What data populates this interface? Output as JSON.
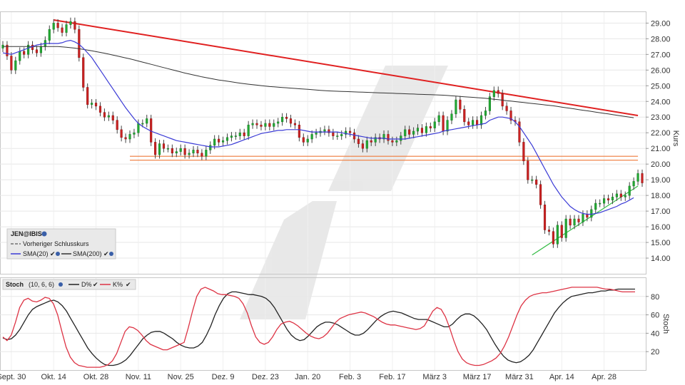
{
  "chart_data": [
    {
      "type": "candlestick",
      "instrument": "JEN@IBIS",
      "ylabel": "Kurs",
      "ylim": [
        13.0,
        29.7
      ],
      "y_ticks": [
        "14.00",
        "15.00",
        "16.00",
        "17.00",
        "18.00",
        "19.00",
        "20.00",
        "21.00",
        "22.00",
        "23.00",
        "24.00",
        "25.00",
        "26.00",
        "27.00",
        "28.00",
        "29.00"
      ],
      "x_ticks": [
        "Sept. 30",
        "Okt. 14",
        "Okt. 28",
        "Nov. 11",
        "Nov. 25",
        "Dez. 9",
        "Dez. 23",
        "Jan. 20",
        "Feb. 3",
        "Feb. 17",
        "März 3",
        "März 17",
        "März 31",
        "Apr. 14",
        "Apr. 28"
      ],
      "legend": {
        "prev_close": "Vorheriger Schlusskurs",
        "sma20": "SMA(20)",
        "sma200": "SMA(200)"
      },
      "colors": {
        "up": "#22aa33",
        "down": "#cc2222",
        "sma20": "#3b3bd6",
        "sma200": "#333333",
        "resistance": "#e02020",
        "support_lines": "#ef7a3a",
        "trend_up": "#33bb44"
      },
      "close": [
        27.6,
        26.9,
        26.0,
        26.6,
        27.2,
        27.0,
        27.6,
        27.3,
        27.1,
        27.5,
        27.9,
        28.6,
        29.0,
        28.7,
        28.4,
        28.9,
        29.1,
        28.6,
        26.8,
        24.9,
        23.8,
        23.9,
        23.7,
        23.3,
        23.0,
        23.1,
        22.8,
        22.2,
        21.7,
        21.6,
        21.9,
        22.0,
        22.6,
        22.6,
        22.9,
        21.4,
        20.6,
        21.3,
        21.0,
        21.0,
        20.7,
        20.8,
        21.0,
        20.6,
        20.7,
        20.9,
        20.7,
        20.5,
        20.9,
        21.2,
        21.6,
        21.4,
        21.5,
        21.7,
        21.8,
        21.8,
        22.0,
        21.8,
        22.5,
        22.6,
        22.5,
        22.4,
        22.6,
        22.4,
        22.6,
        22.7,
        23.0,
        22.9,
        22.6,
        22.5,
        21.7,
        21.4,
        21.6,
        21.9,
        22.0,
        22.1,
        22.2,
        22.0,
        21.8,
        21.8,
        21.9,
        22.1,
        22.0,
        21.6,
        21.3,
        21.0,
        21.5,
        21.4,
        21.7,
        21.6,
        21.9,
        21.5,
        21.4,
        21.5,
        21.8,
        22.2,
        21.9,
        22.1,
        22.3,
        22.0,
        22.4,
        22.3,
        22.7,
        23.1,
        22.1,
        22.8,
        23.2,
        24.1,
        23.5,
        22.7,
        22.5,
        22.8,
        22.5,
        23.1,
        23.4,
        24.3,
        24.7,
        24.5,
        23.7,
        23.4,
        22.8,
        22.7,
        21.4,
        20.2,
        19.0,
        19.0,
        18.7,
        17.4,
        15.8,
        15.7,
        14.9,
        16.1,
        15.3,
        16.5,
        16.1,
        16.5,
        16.3,
        16.8,
        16.6,
        17.1,
        17.5,
        17.5,
        17.8,
        17.7,
        17.9,
        18.1,
        17.9,
        18.0,
        18.6,
        18.9,
        19.4,
        18.8
      ],
      "sma20": [
        27.1,
        27.05,
        27.0,
        27.1,
        27.2,
        27.3,
        27.4,
        27.5,
        27.6,
        27.65,
        27.7,
        27.7,
        27.7,
        27.7,
        27.75,
        27.85,
        27.9,
        27.8,
        27.65,
        27.4,
        27.1,
        26.8,
        26.4,
        26.0,
        25.6,
        25.2,
        24.8,
        24.4,
        24.0,
        23.6,
        23.25,
        22.9,
        22.6,
        22.4,
        22.25,
        22.1,
        22.0,
        21.9,
        21.8,
        21.7,
        21.6,
        21.5,
        21.45,
        21.4,
        21.35,
        21.3,
        21.25,
        21.2,
        21.15,
        21.1,
        21.1,
        21.1,
        21.15,
        21.2,
        21.25,
        21.35,
        21.45,
        21.55,
        21.65,
        21.75,
        21.85,
        21.95,
        22.0,
        22.05,
        22.1,
        22.15,
        22.15,
        22.2,
        22.2,
        22.2,
        22.2,
        22.15,
        22.1,
        22.05,
        22.05,
        22.05,
        22.05,
        22.05,
        22.05,
        22.05,
        22.0,
        21.95,
        21.9,
        21.85,
        21.8,
        21.75,
        21.7,
        21.65,
        21.65,
        21.65,
        21.65,
        21.6,
        21.6,
        21.6,
        21.6,
        21.6,
        21.65,
        21.7,
        21.75,
        21.8,
        21.85,
        21.9,
        21.95,
        22.0,
        22.1,
        22.15,
        22.2,
        22.25,
        22.3,
        22.35,
        22.4,
        22.45,
        22.5,
        22.55,
        22.6,
        22.8,
        22.9,
        23.0,
        23.0,
        22.95,
        22.9,
        22.7,
        22.4,
        22.0,
        21.6,
        21.2,
        20.7,
        20.2,
        19.7,
        19.2,
        18.7,
        18.3,
        17.9,
        17.6,
        17.3,
        17.1,
        16.95,
        16.85,
        16.8,
        16.8,
        16.85,
        16.9,
        17.0,
        17.1,
        17.2,
        17.3,
        17.45,
        17.55,
        17.7,
        17.85
      ],
      "sma200": [
        27.5,
        27.5,
        27.5,
        27.5,
        27.5,
        27.5,
        27.5,
        27.5,
        27.5,
        27.5,
        27.5,
        27.5,
        27.5,
        27.5,
        27.48,
        27.46,
        27.43,
        27.4,
        27.36,
        27.32,
        27.28,
        27.23,
        27.18,
        27.13,
        27.08,
        27.02,
        26.96,
        26.9,
        26.84,
        26.78,
        26.72,
        26.65,
        26.58,
        26.51,
        26.44,
        26.37,
        26.3,
        26.23,
        26.16,
        26.09,
        26.02,
        25.95,
        25.88,
        25.81,
        25.75,
        25.69,
        25.63,
        25.57,
        25.52,
        25.47,
        25.42,
        25.37,
        25.33,
        25.29,
        25.25,
        25.21,
        25.17,
        25.13,
        25.1,
        25.07,
        25.04,
        25.01,
        24.98,
        24.95,
        24.93,
        24.91,
        24.89,
        24.87,
        24.85,
        24.83,
        24.81,
        24.79,
        24.77,
        24.75,
        24.73,
        24.71,
        24.69,
        24.67,
        24.66,
        24.65,
        24.64,
        24.63,
        24.62,
        24.61,
        24.6,
        24.59,
        24.58,
        24.57,
        24.56,
        24.55,
        24.54,
        24.53,
        24.52,
        24.51,
        24.5,
        24.49,
        24.48,
        24.47,
        24.46,
        24.45,
        24.44,
        24.43,
        24.42,
        24.41,
        24.4,
        24.38,
        24.36,
        24.34,
        24.32,
        24.3,
        24.28,
        24.26,
        24.24,
        24.22,
        24.2,
        24.17,
        24.14,
        24.11,
        24.08,
        24.05,
        24.02,
        23.99,
        23.96,
        23.93,
        23.9,
        23.87,
        23.84,
        23.81,
        23.78,
        23.75,
        23.72,
        23.68,
        23.64,
        23.6,
        23.56,
        23.52,
        23.48,
        23.44,
        23.4,
        23.36,
        23.32,
        23.28,
        23.24,
        23.2,
        23.16,
        23.12,
        23.08,
        23.04,
        23.0,
        22.96
      ],
      "lines": {
        "resistance": [
          [
            12,
            29.2
          ],
          [
            150,
            23.1
          ]
        ],
        "support_upper": [
          [
            0,
            20.5
          ],
          [
            150,
            20.5
          ]
        ],
        "support_lower": [
          [
            0,
            20.25
          ],
          [
            150,
            20.25
          ]
        ],
        "uptrend": [
          [
            125,
            14.2
          ],
          [
            150,
            18.6
          ]
        ]
      }
    },
    {
      "type": "line",
      "indicator": "Stoch",
      "params": "(10, 6, 6)",
      "ylabel": "Stoch",
      "ylim": [
        0,
        100
      ],
      "y_ticks": [
        "20",
        "40",
        "60",
        "80"
      ],
      "series": [
        {
          "name": "D%",
          "values": [
            35,
            33,
            34,
            38,
            44,
            52,
            60,
            66,
            69,
            71,
            73,
            75,
            76,
            74,
            70,
            64,
            56,
            48,
            40,
            32,
            24,
            18,
            13,
            9,
            6,
            5,
            5,
            6,
            8,
            11,
            16,
            22,
            28,
            34,
            38,
            41,
            42,
            42,
            40,
            37,
            34,
            30,
            27,
            25,
            24,
            24,
            26,
            30,
            38,
            48,
            60,
            70,
            78,
            83,
            85,
            85,
            84,
            83,
            82,
            82,
            81,
            80,
            78,
            74,
            68,
            60,
            52,
            44,
            38,
            34,
            32,
            33,
            37,
            42,
            47,
            50,
            52,
            52,
            51,
            49,
            46,
            43,
            40,
            38,
            38,
            40,
            44,
            49,
            54,
            58,
            61,
            63,
            64,
            63,
            62,
            60,
            58,
            56,
            55,
            55,
            55,
            53,
            51,
            49,
            47,
            47,
            50,
            55,
            59,
            61,
            61,
            59,
            55,
            50,
            44,
            36,
            28,
            21,
            15,
            11,
            9,
            8,
            9,
            12,
            16,
            22,
            30,
            38,
            46,
            54,
            62,
            68,
            73,
            77,
            80,
            81,
            82,
            83,
            84,
            84,
            85,
            86,
            86,
            87,
            87,
            88,
            88,
            88,
            88,
            88
          ]
        },
        {
          "name": "K%",
          "values": [
            36,
            32,
            38,
            52,
            68,
            76,
            78,
            75,
            74,
            76,
            79,
            78,
            72,
            60,
            42,
            25,
            14,
            8,
            5,
            4,
            3,
            3,
            3,
            3,
            4,
            6,
            10,
            18,
            30,
            42,
            47,
            46,
            43,
            38,
            32,
            28,
            26,
            24,
            22,
            22,
            24,
            26,
            28,
            30,
            46,
            64,
            80,
            88,
            90,
            88,
            86,
            83,
            82,
            82,
            81,
            80,
            78,
            72,
            62,
            48,
            36,
            30,
            28,
            30,
            36,
            44,
            50,
            52,
            53,
            51,
            48,
            44,
            40,
            37,
            35,
            34,
            36,
            40,
            46,
            52,
            56,
            58,
            60,
            61,
            62,
            63,
            62,
            60,
            58,
            55,
            52,
            50,
            49,
            49,
            48,
            47,
            46,
            45,
            44,
            45,
            48,
            56,
            64,
            68,
            66,
            58,
            46,
            32,
            20,
            12,
            8,
            6,
            5,
            5,
            6,
            8,
            10,
            13,
            18,
            26,
            36,
            48,
            60,
            70,
            76,
            80,
            82,
            83,
            84,
            84,
            85,
            86,
            87,
            88,
            89,
            90,
            90,
            90,
            90,
            90,
            90,
            90,
            89,
            88,
            88,
            87,
            86,
            85,
            85,
            85,
            85
          ]
        }
      ],
      "colors": {
        "D%": "#222222",
        "K%": "#dd3344"
      }
    }
  ]
}
